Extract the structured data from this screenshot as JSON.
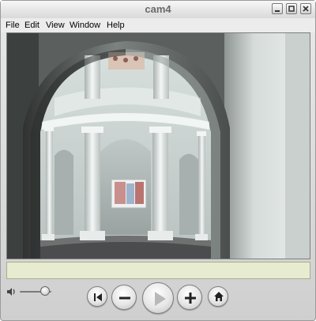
{
  "window": {
    "title": "cam4"
  },
  "menu": {
    "items": [
      "File",
      "Edit",
      "View",
      "Window",
      "Help"
    ]
  },
  "statusbar": {
    "text": ""
  },
  "controls": {
    "volume_level": 0.8,
    "buttons": [
      "go-to-start-icon",
      "zoom-out-icon",
      "play-icon",
      "zoom-in-icon",
      "home-icon"
    ]
  },
  "colors": {
    "titlebar": "#e0e0e0",
    "statusbar": "#e7ebcf",
    "scene_wall": "#c9d1cf",
    "scene_shadow": "#5a5e5c"
  }
}
